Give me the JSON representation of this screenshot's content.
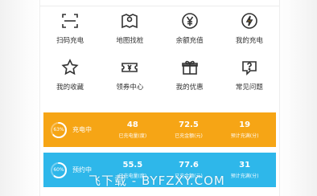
{
  "menu": [
    {
      "label": "扫码充电",
      "icon": "scan-icon"
    },
    {
      "label": "地图找桩",
      "icon": "map-pin-icon"
    },
    {
      "label": "余额充值",
      "icon": "yen-coin-icon"
    },
    {
      "label": "我的充电",
      "icon": "charging-plug-icon"
    },
    {
      "label": "我的收藏",
      "icon": "star-icon"
    },
    {
      "label": "领券中心",
      "icon": "coupon-icon"
    },
    {
      "label": "我的优惠",
      "icon": "gift-icon"
    },
    {
      "label": "常见问题",
      "icon": "question-bubble-icon"
    }
  ],
  "cards": [
    {
      "progress_percent": 63,
      "progress_text": "63%",
      "status": "充电中",
      "color": "#f6a515",
      "stats": [
        {
          "value": "48",
          "label": "已充电量(度)"
        },
        {
          "value": "72.5",
          "label": "已充金额(元)"
        },
        {
          "value": "19",
          "label": "预计充满(分)"
        }
      ]
    },
    {
      "progress_percent": 60,
      "progress_text": "60%",
      "status": "预约中",
      "color": "#2eb7ea",
      "stats": [
        {
          "value": "55.5",
          "label": "已充电量(度)"
        },
        {
          "value": "77.6",
          "label": "已充金额(元)"
        },
        {
          "value": "31",
          "label": "预计充满(分)"
        }
      ]
    }
  ],
  "watermark": "飞下载 - BYFZXY.COM"
}
